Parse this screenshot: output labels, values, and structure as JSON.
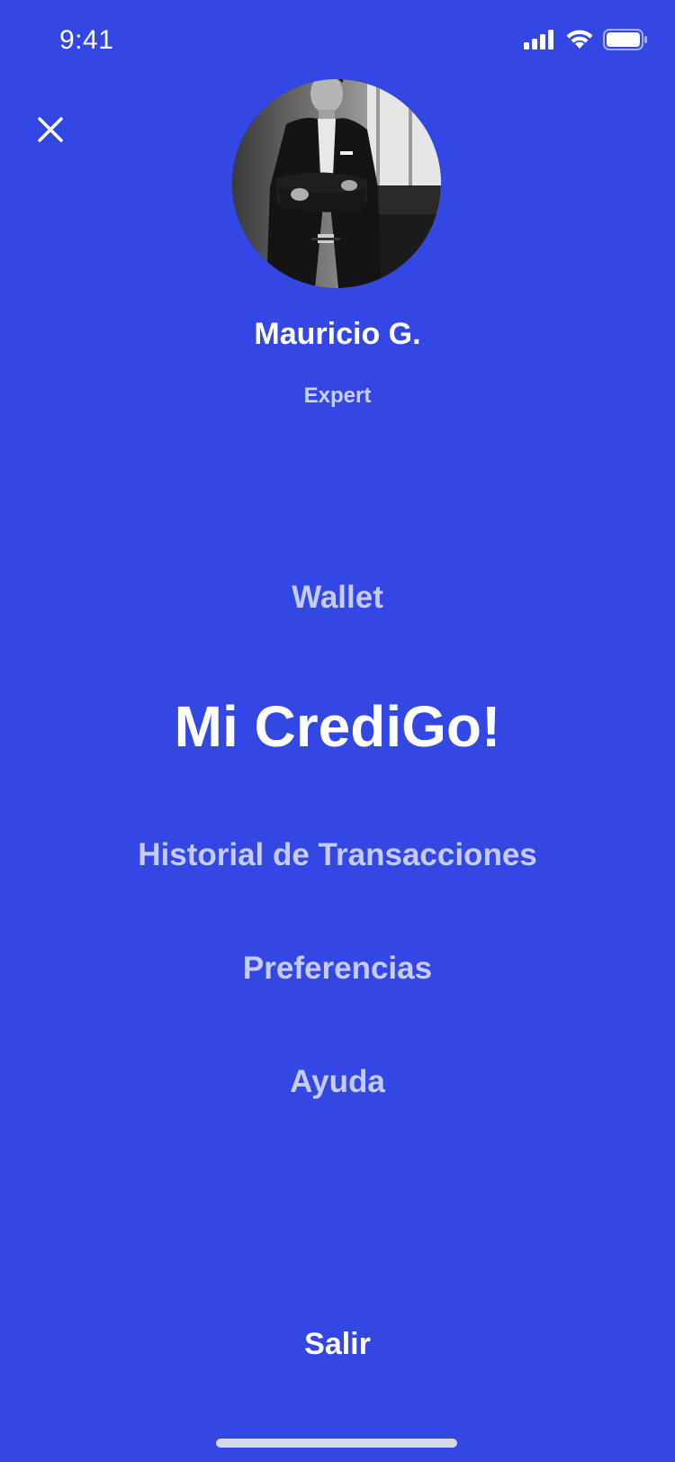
{
  "status_bar": {
    "time": "9:41",
    "signal_icon": "cellular-signal-icon",
    "wifi_icon": "wifi-icon",
    "battery_icon": "battery-icon"
  },
  "header": {
    "close_icon": "close-icon"
  },
  "profile": {
    "name": "Mauricio G.",
    "role": "Expert",
    "avatar_icon": "avatar-photo"
  },
  "menu": {
    "items": [
      {
        "label": "Wallet",
        "active": false
      },
      {
        "label": "Mi CrediGo!",
        "active": true
      },
      {
        "label": "Historial de Transacciones",
        "active": false
      },
      {
        "label": "Preferencias",
        "active": false
      },
      {
        "label": "Ayuda",
        "active": false
      }
    ]
  },
  "footer": {
    "logout_label": "Salir"
  },
  "colors": {
    "background": "#3347E5",
    "text_primary": "#FFFFFF",
    "text_muted": "#C7CCF7"
  }
}
